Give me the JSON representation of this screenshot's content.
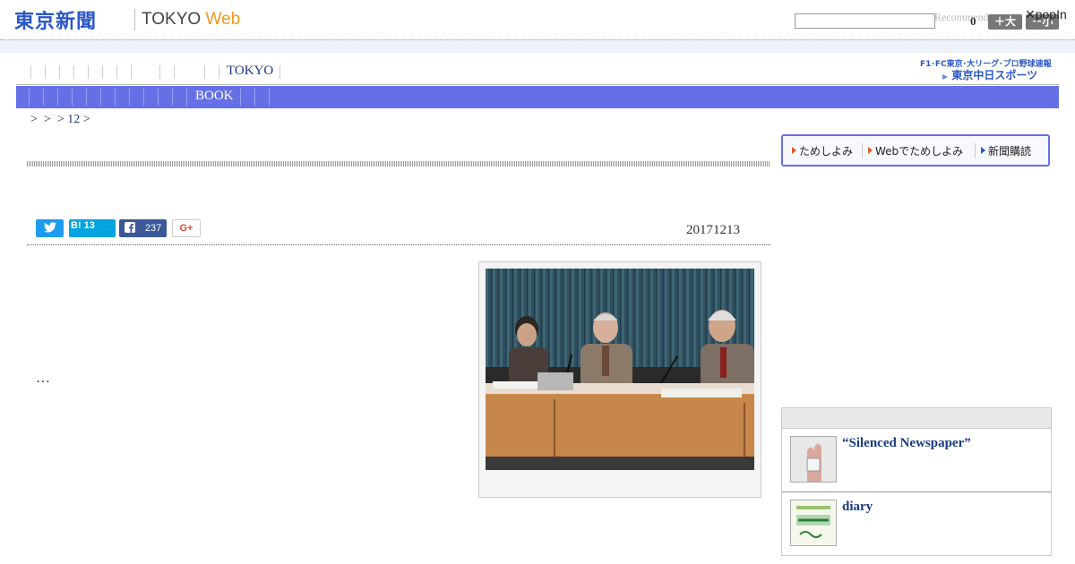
{
  "header": {
    "logo_ja": "東京新聞",
    "logo_en": "TOKYO",
    "logo_web": "Web",
    "search_placeholder": "",
    "recommend": "Recommend",
    "count": "0",
    "font_larger": "＋大",
    "font_smaller": "－小",
    "popin": "✕popIn"
  },
  "nav": {
    "top_label": "TOKYO",
    "bar_label": "BOOK",
    "sports_tagline": "F1･FC東京･大リーグ･プロ野球速報",
    "sports_name": "東京中日スポーツ"
  },
  "breadcrumb": {
    "sep1": ">",
    "sep2": ">",
    "sep3": ">",
    "link": "12",
    "sep4": ">"
  },
  "article": {
    "share_twitter": "",
    "share_hatena": "B! 13",
    "share_facebook": "237",
    "share_google": "G+",
    "date": "20171213",
    "body": "…"
  },
  "sidebar": {
    "subscribe": [
      {
        "label": "ためしよみ"
      },
      {
        "label": "Webでためしよみ"
      },
      {
        "label": "新聞購読"
      }
    ],
    "items": [
      {
        "title": "“Silenced Newspaper”"
      },
      {
        "title": "diary"
      }
    ]
  },
  "colors": {
    "brand_blue": "#2a56c6",
    "nav_bar": "#6670e6",
    "accent_orange": "#f0961e"
  }
}
